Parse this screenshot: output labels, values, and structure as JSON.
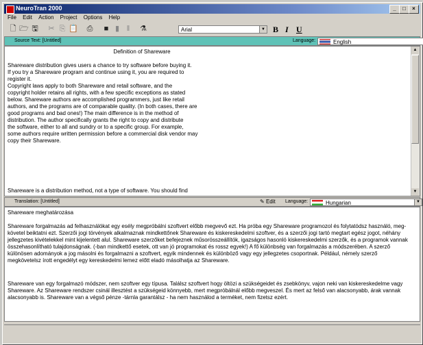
{
  "window": {
    "title": "NeuroTran 2000"
  },
  "menu": [
    "File",
    "Edit",
    "Action",
    "Project",
    "Options",
    "Help"
  ],
  "toolbar": {
    "font": "Arial",
    "bold": "B",
    "italic": "I",
    "underline": "U"
  },
  "source": {
    "label": "Source Text: [Untitled]",
    "lang_label": "Language:",
    "language": "English",
    "heading": "Definition of Shareware",
    "body": "Shareware distribution gives users a chance to try software before buying it.\nIf you try a Shareware program and continue using it, you are required to\nregister it.\nCopyright laws apply to both Shareware and retail software, and the\ncopyright holder retains all rights, with a few specific exceptions as stated\nbelow. Shareware authors are accomplished programmers, just like retail\nauthors, and the programs are of comparable quality. (In both cases, there are\ngood programs and bad ones!) The main difference is in the method of\ndistribution. The author specifically grants the right to copy and distribute\nthe software, either to all and sundry or to a specific group. For example,\nsome authors require written permission before a commercial disk vendor may\ncopy their Shareware.",
    "cut_line": "Shareware is a distribution method, not a type of software. You should find"
  },
  "translation": {
    "label": "Translation: [Untitled]",
    "edit_label": "Edit",
    "lang_label": "Language:",
    "language": "Hungarian",
    "heading": "Shareware meghatározása",
    "para1": "Shareware forgalmazás ad felhasználókat egy esély megpróbálni szoftvert előbb megvevő ezt. Ha próba egy Shareware programozol és folytatódsz használó, meg-követel beiktatni ezt. Szerzői jogi törvények alkalmaznak mindkettőnek Shareware és kiskereskedelmi szoftver, és a szerzői jogi tartó megtart egész jogot, néhány jellegzetes kivételekkel mint kijelentett alul. Shareware szerzőket befejeznek műsorösszeállítók, igazságos hasonló kiskereskedelmi szerzők, és a programok vannak összehasonlítható tulajdonságnak. (-ban mindkettő esetek, ott van jó programokat és rossz egyek!) A fő különbség van forgalmazás a módszerében. A szerző különösen adományok a jog másolni és forgalmazni a szoftvert, egyik mindennek és különböző vagy egy jellegzetes csoportnak. Például, némely szerző megkövetelsz írott engedélyt egy kereskedelmi lemez előtt eladó másolhatja az Shareware.",
    "para2": "Shareware van egy forgalmazó módszer, nem szoftver egy típusa. Találsz szoftvert hogy öltözi a szükségeidet és zsebkönyv, vajon neki van kiskereskedelme vagy Shareware. Az Shareware rendszer csinál illesztést a szükségeid könnyebb, mert megpróbálnál előbb megveszel. És mert az felső van alacsonyabb, árak vannak alacsonyabb is. Shareware van a végső pénze -tárnla garantálsz - ha nem használod a terméket, nem fizetsz ezért."
  }
}
